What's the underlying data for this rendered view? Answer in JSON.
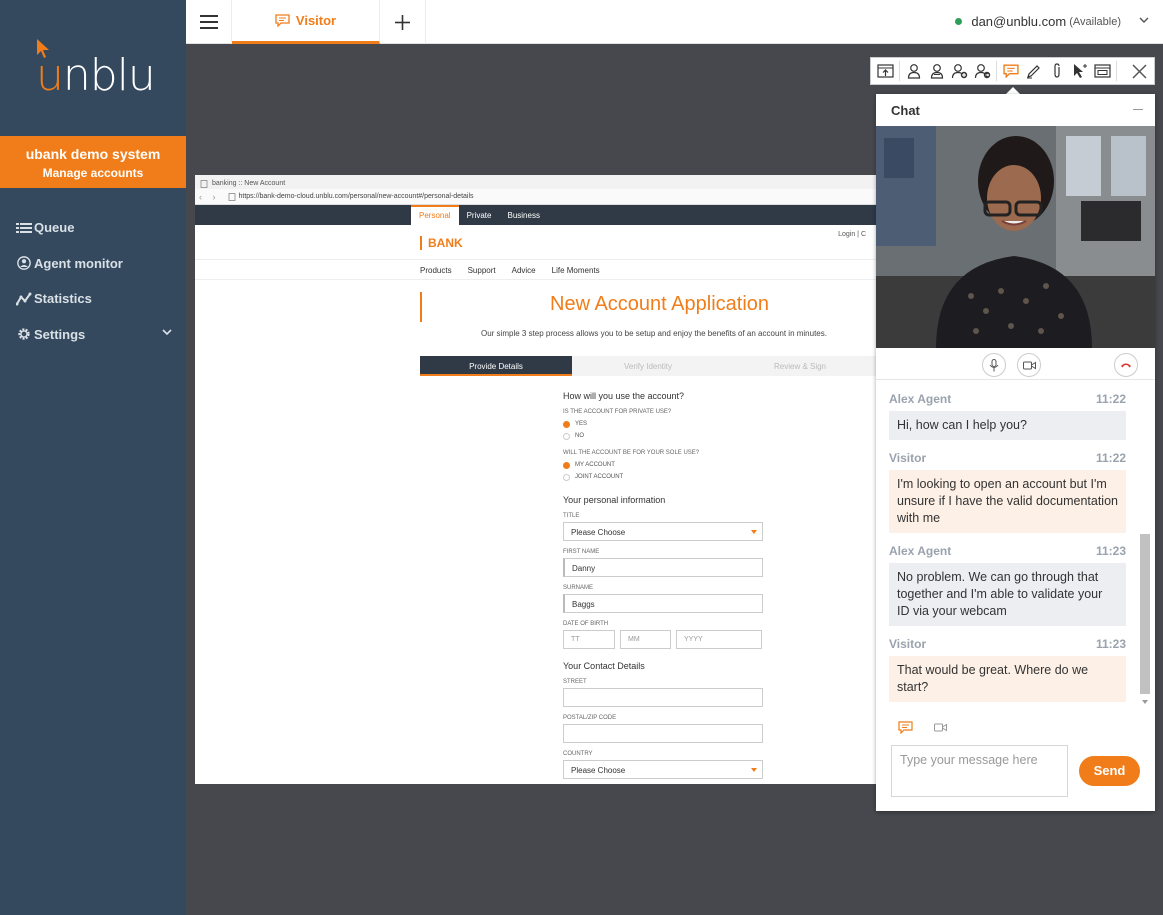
{
  "brand": {
    "logo_text_u": "u",
    "logo_text_rest": "nblu",
    "accent_color": "#f07d1a",
    "sidebar_color": "#34495e"
  },
  "org": {
    "name": "ubank demo system",
    "subtitle": "Manage accounts"
  },
  "sidebar": {
    "items": [
      {
        "label": "Queue",
        "icon": "list-icon"
      },
      {
        "label": "Agent monitor",
        "icon": "agent-monitor-icon"
      },
      {
        "label": "Statistics",
        "icon": "statistics-icon"
      },
      {
        "label": "Settings",
        "icon": "gear-icon"
      }
    ]
  },
  "topbar": {
    "tab_label": "Visitor",
    "user_email": "dan@unblu.com",
    "user_status": "(Available)",
    "status_color": "#2e9e5b"
  },
  "cobrowse": {
    "window_title": "banking :: New Account",
    "url": "https://bank-demo-cloud.unblu.com/personal/new-account#/personal-details",
    "top_tabs": [
      "Personal",
      "Private",
      "Business"
    ],
    "logo": "BANK",
    "login": "Login  |  C",
    "menu": [
      "Products",
      "Support",
      "Advice",
      "Life Moments"
    ],
    "heading": "New Account Application",
    "intro": "Our simple 3 step process allows you to be setup and enjoy the benefits of an account in minutes.",
    "steps": [
      "Provide Details",
      "Verify Identity",
      "Review & Sign"
    ],
    "form": {
      "q1": "How will you use the account?",
      "private_label": "Is the account for private use?",
      "private_options": [
        "YES",
        "NO"
      ],
      "sole_label": "Will the account be for your sole use?",
      "sole_options": [
        "MY ACCOUNT",
        "JOINT ACCOUNT"
      ],
      "personal_heading": "Your personal information",
      "title_label": "Title",
      "title_value": "Please Choose",
      "first_name_label": "First name",
      "first_name_value": "Danny",
      "surname_label": "Surname",
      "surname_value": "Baggs",
      "dob_label": "Date of birth",
      "dob_placeholders": [
        "TT",
        "MM",
        "YYYY"
      ],
      "contact_heading": "Your Contact Details",
      "street_label": "Street",
      "postal_label": "Postal/Zip code",
      "country_label": "Country",
      "country_value": "Please Choose"
    }
  },
  "chat": {
    "title": "Chat",
    "messages": [
      {
        "sender": "Alex Agent",
        "time": "11:22",
        "text": "Hi, how can I help you?",
        "role": "agent"
      },
      {
        "sender": "Visitor",
        "time": "11:22",
        "text": "I'm looking to open an account but I'm unsure if I have the valid documentation with me",
        "role": "visitor"
      },
      {
        "sender": "Alex Agent",
        "time": "11:23",
        "text": "No problem. We can go through that together and I'm able to validate your ID via your webcam",
        "role": "agent"
      },
      {
        "sender": "Visitor",
        "time": "11:23",
        "text": "That would be great. Where do we start?",
        "role": "visitor"
      }
    ],
    "input_placeholder": "Type your message here",
    "send_label": "Send"
  }
}
